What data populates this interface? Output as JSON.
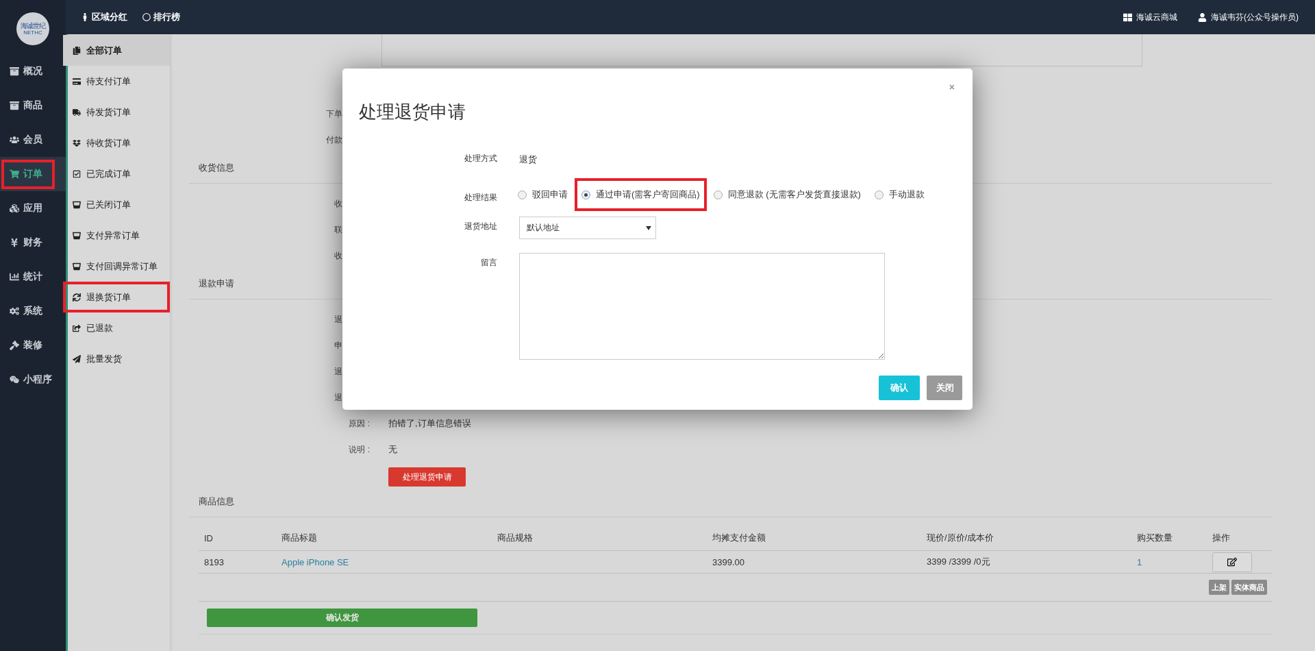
{
  "logo": {
    "name": "海诚世纪",
    "tag": "NETHC"
  },
  "topbar": {
    "links": [
      {
        "label": "区域分红"
      },
      {
        "label": "排行榜"
      }
    ],
    "right": [
      {
        "label": "海诚云商城"
      },
      {
        "label": "海诚韦芬(公众号操作员)"
      }
    ]
  },
  "nav": [
    {
      "label": "概况",
      "selected": false,
      "highlighted": false
    },
    {
      "label": "商品",
      "selected": false,
      "highlighted": false
    },
    {
      "label": "会员",
      "selected": false,
      "highlighted": false
    },
    {
      "label": "订单",
      "selected": true,
      "highlighted": true
    },
    {
      "label": "应用",
      "selected": false,
      "highlighted": false
    },
    {
      "label": "财务",
      "selected": false,
      "highlighted": false
    },
    {
      "label": "统计",
      "selected": false,
      "highlighted": false
    },
    {
      "label": "系统",
      "selected": false,
      "highlighted": false
    },
    {
      "label": "装修",
      "selected": false,
      "highlighted": false
    },
    {
      "label": "小程序",
      "selected": false,
      "highlighted": false
    }
  ],
  "subnav": [
    {
      "label": "全部订单",
      "selected": true,
      "highlighted": false
    },
    {
      "label": "待支付订单",
      "selected": false,
      "highlighted": false
    },
    {
      "label": "待发货订单",
      "selected": false,
      "highlighted": false
    },
    {
      "label": "待收货订单",
      "selected": false,
      "highlighted": false
    },
    {
      "label": "已完成订单",
      "selected": false,
      "highlighted": false
    },
    {
      "label": "已关闭订单",
      "selected": false,
      "highlighted": false
    },
    {
      "label": "支付异常订单",
      "selected": false,
      "highlighted": false
    },
    {
      "label": "支付回调异常订单",
      "selected": false,
      "highlighted": false
    },
    {
      "label": "退换货订单",
      "selected": false,
      "highlighted": true
    },
    {
      "label": "已退款",
      "selected": false,
      "highlighted": false
    },
    {
      "label": "批量发货",
      "selected": false,
      "highlighted": false
    }
  ],
  "detail_rows": [
    {
      "label": "下单"
    },
    {
      "label": "付款"
    }
  ],
  "sections": [
    {
      "title": "收货信息",
      "rows": [
        {
          "label": "收"
        },
        {
          "label": "联"
        },
        {
          "label": "收"
        }
      ]
    },
    {
      "title": "退款申请",
      "rows": [
        {
          "label": "退"
        },
        {
          "label": "申"
        },
        {
          "label": "退"
        },
        {
          "label": "退"
        },
        {
          "label": "原因 :",
          "value": "拍错了,订单信息错误"
        },
        {
          "label": "说明 :",
          "value": "无"
        }
      ],
      "action": "处理退货申请"
    }
  ],
  "products": {
    "title": "商品信息",
    "columns": [
      "ID",
      "商品标题",
      "商品规格",
      "均摊支付金额",
      "现价/原价/成本价",
      "购买数量",
      "操作"
    ],
    "rows": [
      {
        "id": "8193",
        "title": "Apple iPhone SE",
        "amount": "3399.00",
        "prices": "3399 /3399 /0元",
        "quantity": "1",
        "tags": [
          "上架",
          "实体商品"
        ]
      }
    ],
    "ship_button": "确认发货"
  },
  "modal": {
    "title": "处理退货申请",
    "close": "×",
    "fields": [
      {
        "kind": "text",
        "label": "处理方式",
        "value": "退货"
      },
      {
        "kind": "radio",
        "label": "处理结果",
        "options": [
          {
            "label": "驳回申请",
            "selected": false,
            "highlighted": false
          },
          {
            "label": "通过申请(需客户寄回商品)",
            "selected": true,
            "highlighted": true
          },
          {
            "label": "同意退款 (无需客户发货直接退款)",
            "selected": false,
            "highlighted": false
          },
          {
            "label": "手动退款",
            "selected": false,
            "highlighted": false
          }
        ]
      },
      {
        "kind": "select",
        "label": "退货地址",
        "value": "默认地址"
      },
      {
        "kind": "textarea",
        "label": "留言"
      }
    ],
    "buttons": [
      {
        "kind": "primary",
        "label": "确认"
      },
      {
        "kind": "default",
        "label": "关闭"
      }
    ]
  }
}
